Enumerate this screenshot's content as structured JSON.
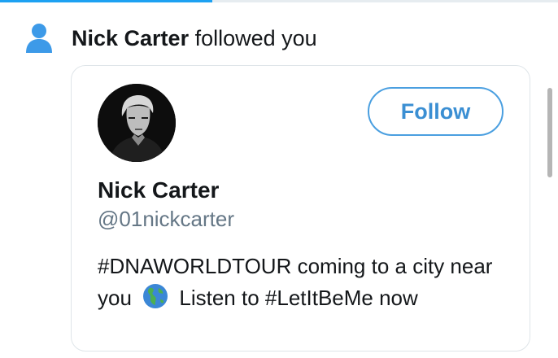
{
  "progress": {
    "fraction": 0.38,
    "color": "#1da1f2"
  },
  "notification": {
    "icon": "person-icon",
    "name": "Nick Carter",
    "action": "followed you"
  },
  "profile_card": {
    "avatar": "profile-photo",
    "follow_label": "Follow",
    "display_name": "Nick Carter",
    "handle": "@01nickcarter",
    "bio_part1": "#DNAWORLDTOUR coming to a city near you",
    "bio_emoji": "globe-icon",
    "bio_part2": "Listen to #LetItBeMe now"
  },
  "colors": {
    "accent": "#1da1f2",
    "follow_border": "#4a9fe0",
    "text": "#14171a",
    "muted": "#657786"
  }
}
